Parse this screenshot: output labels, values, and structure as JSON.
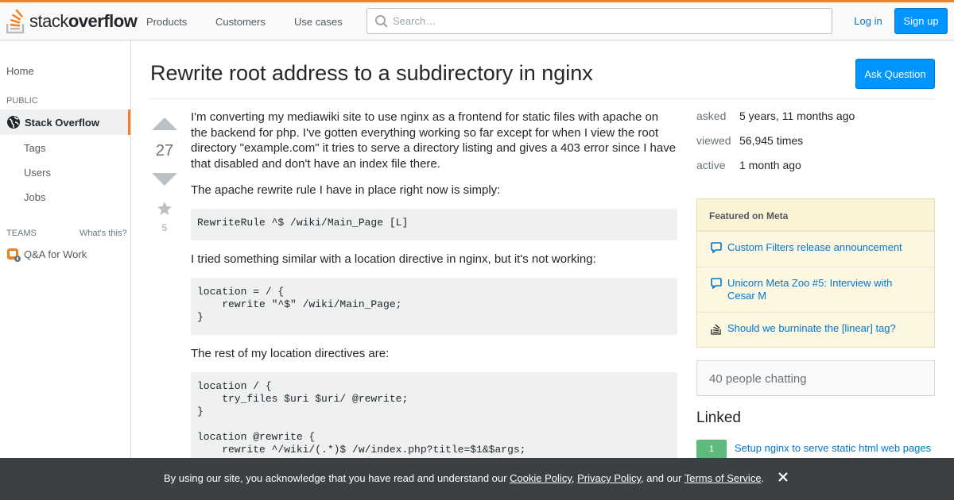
{
  "header": {
    "logo_light": "stack",
    "logo_bold": "overflow",
    "nav": [
      "Products",
      "Customers",
      "Use cases"
    ],
    "search_placeholder": "Search…",
    "login_label": "Log in",
    "signup_label": "Sign up"
  },
  "sidebar": {
    "home": "Home",
    "public_label": "PUBLIC",
    "active_item": "Stack Overflow",
    "sub_items": [
      "Tags",
      "Users",
      "Jobs"
    ],
    "teams_label": "TEAMS",
    "whats_this": "What's this?",
    "teams_item": "Q&A for Work"
  },
  "question": {
    "title": "Rewrite root address to a subdirectory in nginx",
    "ask_button": "Ask Question",
    "votes": "27",
    "favorites": "5",
    "paragraph1": "I'm converting my mediawiki site to use nginx as a frontend for static files with apache on the backend for php. I've gotten everything working so far except for when I view the root directory \"example.com\" it tries to serve a directory listing and gives a 403 error since I have that disabled and don't have an index file there.",
    "paragraph2": "The apache rewrite rule I have in place right now is simply:",
    "code1": "RewriteRule ^$ /wiki/Main_Page [L]",
    "paragraph3": "I tried something similar with a location directive in nginx, but it's not working:",
    "code2": "location = / {\n    rewrite \"^$\" /wiki/Main_Page;\n}",
    "paragraph4": "The rest of my location directives are:",
    "code3": "location / {\n    try_files $uri $uri/ @rewrite;\n}\n\nlocation @rewrite {\n    rewrite ^/wiki/(.*)$ /w/index.php?title=$1&$args;"
  },
  "meta": {
    "asked_label": "asked",
    "asked_value": "5 years, 11 months ago",
    "viewed_label": "viewed",
    "viewed_value": "56,945 times",
    "active_label": "active",
    "active_value": "1 month ago"
  },
  "featured": {
    "heading": "Featured on Meta",
    "items": [
      "Custom Filters release announcement",
      "Unicorn Meta Zoo #5: Interview with Cesar M",
      "Should we burninate the [linear] tag?"
    ]
  },
  "chat": "40 people chatting",
  "linked": {
    "heading": "Linked",
    "badge": "1",
    "link": "Setup nginx to serve static html web pages"
  },
  "cookie": {
    "prefix": "By using our site, you acknowledge that you have read and understand our ",
    "cookie_policy": "Cookie Policy",
    "sep1": ", ",
    "privacy_policy": "Privacy Policy",
    "sep2": ", and our ",
    "terms": "Terms of Service",
    "suffix": "."
  },
  "colors": {
    "accent": "#f48024",
    "primary_button": "#0095ff",
    "link": "#0077cc"
  }
}
